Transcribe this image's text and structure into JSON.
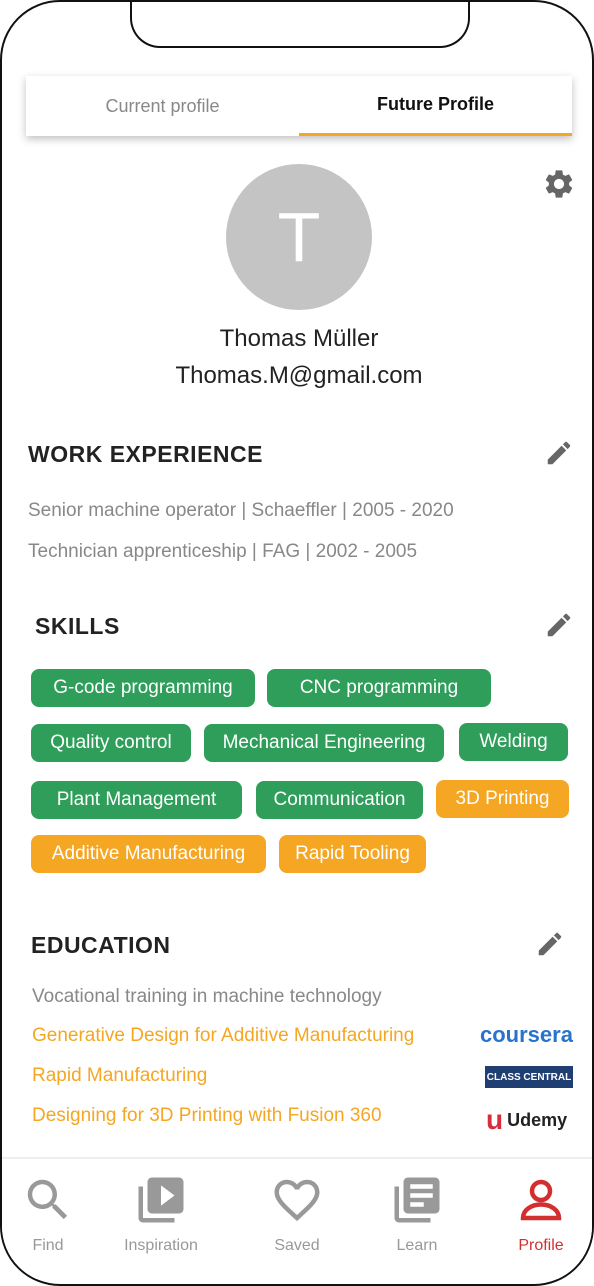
{
  "tabs": {
    "current": "Current profile",
    "future": "Future Profile"
  },
  "profile": {
    "initial": "T",
    "name": "Thomas Müller",
    "email": "Thomas.M@gmail.com"
  },
  "work": {
    "title": "WORK EXPERIENCE",
    "items": [
      "Senior machine operator | Schaeffler | 2005 - 2020",
      "Technician apprenticeship | FAG | 2002 - 2005"
    ]
  },
  "skills": {
    "title": "SKILLS",
    "items": [
      {
        "label": "G-code programming",
        "color": "#2e9e5a"
      },
      {
        "label": "CNC programming",
        "color": "#2e9e5a"
      },
      {
        "label": "Quality control",
        "color": "#2e9e5a"
      },
      {
        "label": "Mechanical Engineering",
        "color": "#2e9e5a"
      },
      {
        "label": "Welding",
        "color": "#2e9e5a"
      },
      {
        "label": "Plant Management",
        "color": "#2e9e5a"
      },
      {
        "label": "Communication",
        "color": "#2e9e5a"
      },
      {
        "label": "3D Printing",
        "color": "#f5a623"
      },
      {
        "label": "Additive Manufacturing",
        "color": "#f5a623"
      },
      {
        "label": "Rapid Tooling",
        "color": "#f5a623"
      }
    ]
  },
  "education": {
    "title": "EDUCATION",
    "static": "Vocational training in machine technology",
    "courses": [
      {
        "label": "Generative Design for Additive Manufacturing",
        "provider": "coursera"
      },
      {
        "label": "Rapid Manufacturing",
        "provider": "CLASS CENTRAL"
      },
      {
        "label": "Designing for 3D Printing with Fusion 360",
        "provider": "Udemy"
      }
    ]
  },
  "nav": {
    "items": [
      {
        "label": "Find",
        "icon": "search-icon"
      },
      {
        "label": "Inspiration",
        "icon": "video-library-icon"
      },
      {
        "label": "Saved",
        "icon": "heart-icon"
      },
      {
        "label": "Learn",
        "icon": "library-books-icon"
      },
      {
        "label": "Profile",
        "icon": "person-icon"
      }
    ],
    "active_color": "#d32f2f"
  }
}
